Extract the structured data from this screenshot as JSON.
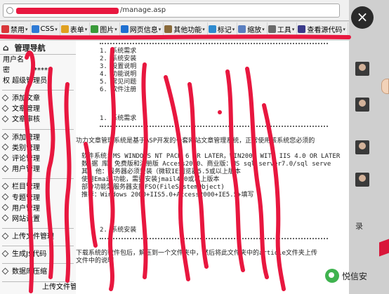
{
  "browser": {
    "url_suffix": "/manage.asp",
    "toolbar": [
      {
        "label": "禁用",
        "icon": "disable-icon",
        "color": "#d9373a"
      },
      {
        "label": "CSS",
        "icon": "css-icon",
        "color": "#2f7bd6"
      },
      {
        "label": "表单",
        "icon": "form-icon",
        "color": "#e0a020"
      },
      {
        "label": "图片",
        "icon": "image-icon",
        "color": "#3a9a3a"
      },
      {
        "label": "网页信息",
        "icon": "info-icon",
        "color": "#1f6fd1"
      },
      {
        "label": "其他功能",
        "icon": "misc-icon",
        "color": "#8a6a3a"
      },
      {
        "label": "标记",
        "icon": "mark-icon",
        "color": "#2e8bd0"
      },
      {
        "label": "缩放",
        "icon": "zoom-icon",
        "color": "#5a7fc0"
      },
      {
        "label": "工具",
        "icon": "tools-icon",
        "color": "#6a6a6a"
      },
      {
        "label": "查看源代码",
        "icon": "source-icon",
        "color": "#3a3a8a"
      }
    ]
  },
  "nav": {
    "header": "管理导航",
    "user_lines": [
      "用户名",
      "密",
      "权 超级管理员"
    ],
    "password_mask": "*****",
    "groups": [
      [
        "添加文章",
        "文章管理",
        "文章审核"
      ],
      [
        "添加管理",
        "类别管理",
        "评论管理",
        "用户管理"
      ],
      [
        "栏目管理",
        "专题管理",
        "用户管理",
        "网站设置"
      ],
      [
        "上传文件管理"
      ],
      [
        "生成JS代码"
      ],
      [
        "数据库压缩"
      ]
    ],
    "last_item": "上传文件管理"
  },
  "main": {
    "toc": [
      "1. 系统需求",
      "2. 系统安装",
      "3. 设置说明",
      "4. 功能说明",
      "5. 常见问题",
      "6. 软件注册"
    ],
    "section1_title": "1. 系统需求",
    "section1_intro": "功力文章管理系统是基于ASP开发的一套网站文章管理系统，正常使用该系统您必须的",
    "section1_lines": [
      "软件系统：MS WINDOWS NT PACK 6 OR LATER，WIN2000 WITH IIS 4.0 OR LATER",
      "数 据 库：免费版和注册版 Access2000、商业版：MS sql server7.0/sql serve",
      "其  他：服务器必须安装（微软IE浏览器5.5或以上版本",
      "使用Email功能，需要安装jmail4.0或以上版本",
      "部分功能需服务器支持FSO(FileSystemObject)",
      "推荐：Windows 2000+IIS5.0+Access2000+IE5.5+填写"
    ],
    "section2_title": "2. 系统安装",
    "section2_lines": [
      "下载系统的软件包后，解压到一个文件夹中，然后将此文件夹中的article文件夹上传",
      "文件中的说明"
    ]
  },
  "overlay": {
    "close": "×",
    "side_text": "录",
    "watermark": "悦信安"
  },
  "colors": {
    "scribble": "#e8173f"
  }
}
